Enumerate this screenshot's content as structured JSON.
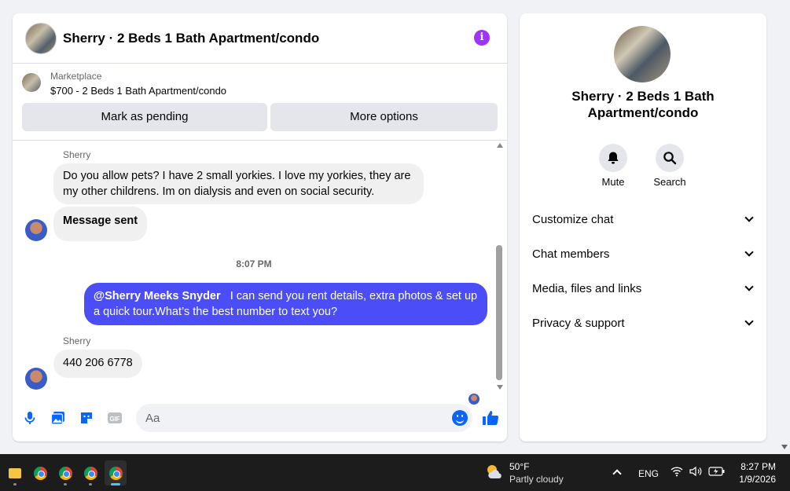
{
  "chat": {
    "title": "Sherry · 2 Beds 1 Bath Apartment/condo",
    "listing_source": "Marketplace",
    "listing_price_title": "$700 - 2 Beds 1 Bath Apartment/condo",
    "mark_pending_label": "Mark as pending",
    "more_options_label": "More options",
    "messages": [
      {
        "sender": "Sherry",
        "text": "Do you allow pets? I have 2 small yorkies. I love my yorkies, they are my other childrens. Im on dialysis and even on social security.",
        "direction": "in"
      },
      {
        "text": "Message sent",
        "direction": "in"
      },
      {
        "timestamp": "8:07 PM"
      },
      {
        "mention": "@Sherry Meeks Snyder",
        "text": "I can send you rent details, extra photos & set up a quick tour.What’s the best number to text you?",
        "direction": "out"
      },
      {
        "sender": "Sherry",
        "text": "440 206 6778",
        "direction": "in"
      }
    ],
    "composer_placeholder": "Aa",
    "accent_color": "#4b4ef6"
  },
  "info": {
    "title": "Sherry · 2 Beds 1 Bath Apartment/condo",
    "actions": [
      {
        "label": "Mute",
        "icon": "bell-icon"
      },
      {
        "label": "Search",
        "icon": "search-icon"
      }
    ],
    "sections": [
      "Customize chat",
      "Chat members",
      "Media, files and links",
      "Privacy & support"
    ]
  },
  "taskbar": {
    "weather_temp": "50°F",
    "weather_desc": "Partly cloudy",
    "language": "ENG",
    "time": "8:27 PM",
    "date": "1/9/2026"
  }
}
